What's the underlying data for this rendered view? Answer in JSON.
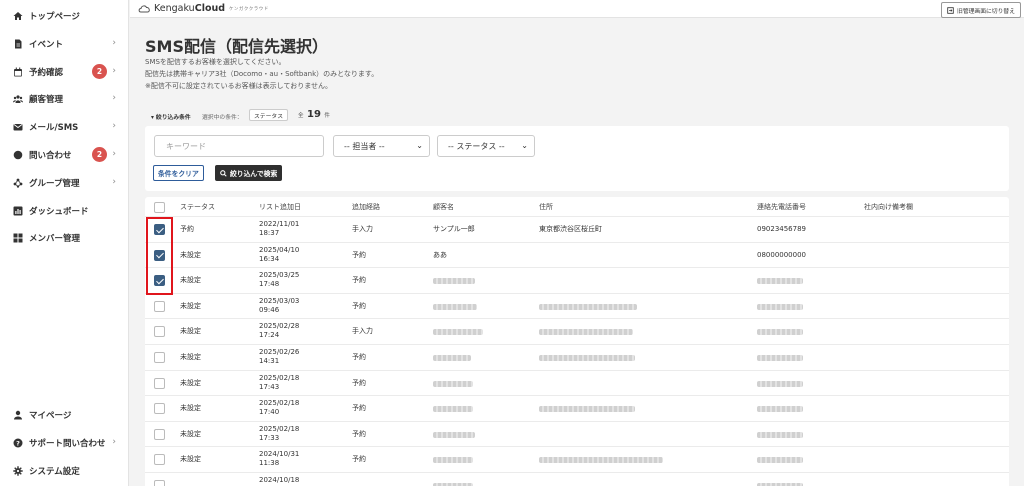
{
  "sidebar": {
    "items": [
      {
        "label": "トップページ",
        "icon": "home-icon",
        "chevron": false,
        "badge": ""
      },
      {
        "label": "イベント",
        "icon": "document-icon",
        "chevron": true,
        "badge": ""
      },
      {
        "label": "予約確認",
        "icon": "calendar-icon",
        "chevron": true,
        "badge": "2"
      },
      {
        "label": "顧客管理",
        "icon": "users-icon",
        "chevron": true,
        "badge": ""
      },
      {
        "label": "メール/SMS",
        "icon": "mail-icon",
        "chevron": true,
        "badge": ""
      },
      {
        "label": "問い合わせ",
        "icon": "chat-icon",
        "chevron": true,
        "badge": "2"
      },
      {
        "label": "グループ管理",
        "icon": "group-icon",
        "chevron": true,
        "badge": ""
      },
      {
        "label": "ダッシュボード",
        "icon": "chart-icon",
        "chevron": false,
        "badge": ""
      },
      {
        "label": "メンバー管理",
        "icon": "grid-icon",
        "chevron": false,
        "badge": ""
      }
    ],
    "bottom_items": [
      {
        "label": "マイページ",
        "icon": "person-icon",
        "chevron": false
      },
      {
        "label": "サポート問い合わせ",
        "icon": "help-icon",
        "chevron": true
      },
      {
        "label": "システム設定",
        "icon": "gear-icon",
        "chevron": false
      }
    ]
  },
  "header": {
    "logo_light": "Kengaku",
    "logo_bold": "Cloud",
    "logo_sub": "ケンガククラウド",
    "switch_label": "旧管理画面に切り替え"
  },
  "page": {
    "title": "SMS配信（配信先選択）",
    "desc": [
      "SMSを配信するお客様を選択してください。",
      "配信先は携帯キャリア3社（Docomo・au・Softbank）のみとなります。",
      "※配信不可に設定されているお客様は表示しておりません。"
    ]
  },
  "filter": {
    "label": "▾ 絞り込み条件",
    "selected_label": "選択中の条件：",
    "selected_tag": "ステータス",
    "count_prefix": "全",
    "count": "19",
    "count_suffix": "件",
    "keyword_placeholder": "キーワード",
    "staff_select": "-- 担当者 --",
    "status_select": "-- ステータス --",
    "clear_button": "条件をクリア",
    "search_button": "絞り込んで検索"
  },
  "table": {
    "headers": [
      "ステータス",
      "リスト追加日",
      "追加経路",
      "顧客名",
      "住所",
      "連絡先電話番号",
      "社内向け備考欄"
    ],
    "rows": [
      {
        "checked": true,
        "status": "予約",
        "date": "2022/11/01",
        "time": "18:37",
        "route": "手入力",
        "name": "サンプル一郎",
        "address": "東京都渋谷区桜丘町",
        "phone": "09023456789"
      },
      {
        "checked": true,
        "status": "未設定",
        "date": "2025/04/10",
        "time": "16:34",
        "route": "予約",
        "name": "ああ",
        "address": "",
        "phone": "08000000000"
      },
      {
        "checked": true,
        "status": "未設定",
        "date": "2025/03/25",
        "time": "17:48",
        "route": "予約",
        "name": "",
        "address": "",
        "phone": ""
      },
      {
        "checked": false,
        "status": "未設定",
        "date": "2025/03/03",
        "time": "09:46",
        "route": "予約",
        "name": "",
        "address": "",
        "phone": ""
      },
      {
        "checked": false,
        "status": "未設定",
        "date": "2025/02/28",
        "time": "17:24",
        "route": "手入力",
        "name": "",
        "address": "",
        "phone": ""
      },
      {
        "checked": false,
        "status": "未設定",
        "date": "2025/02/26",
        "time": "14:31",
        "route": "予約",
        "name": "",
        "address": "",
        "phone": ""
      },
      {
        "checked": false,
        "status": "未設定",
        "date": "2025/02/18",
        "time": "17:43",
        "route": "予約",
        "name": "",
        "address": "",
        "phone": ""
      },
      {
        "checked": false,
        "status": "未設定",
        "date": "2025/02/18",
        "time": "17:40",
        "route": "予約",
        "name": "",
        "address": "",
        "phone": ""
      },
      {
        "checked": false,
        "status": "未設定",
        "date": "2025/02/18",
        "time": "17:33",
        "route": "予約",
        "name": "",
        "address": "",
        "phone": ""
      },
      {
        "checked": false,
        "status": "未設定",
        "date": "2024/10/31",
        "time": "11:38",
        "route": "予約",
        "name": "",
        "address": "",
        "phone": ""
      },
      {
        "checked": false,
        "status": "",
        "date": "2024/10/18",
        "time": "",
        "route": "",
        "name": "",
        "address": "",
        "phone": ""
      }
    ]
  },
  "colors": {
    "accent": "#3b5e82",
    "badge": "#d9534f",
    "highlight": "#e0151c"
  }
}
